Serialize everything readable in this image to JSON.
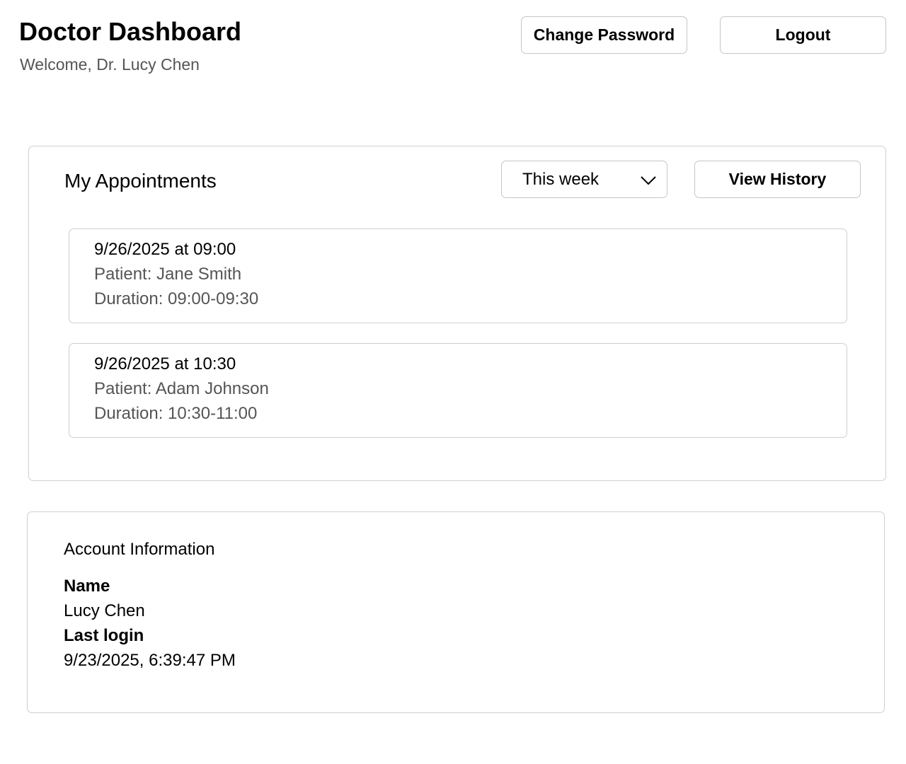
{
  "header": {
    "title": "Doctor Dashboard",
    "subtitle": "Welcome, Dr. Lucy Chen",
    "change_password_label": "Change Password",
    "logout_label": "Logout"
  },
  "appointments": {
    "title": "My Appointments",
    "filter": {
      "selected": "This week"
    },
    "view_history_label": "View History",
    "items": [
      {
        "datetime": "9/26/2025 at 09:00",
        "patient": "Patient: Jane Smith",
        "duration": "Duration: 09:00-09:30"
      },
      {
        "datetime": "9/26/2025 at 10:30",
        "patient": "Patient: Adam Johnson",
        "duration": "Duration: 10:30-11:00"
      }
    ]
  },
  "account": {
    "title": "Account Information",
    "name_label": "Name",
    "name_value": "Lucy Chen",
    "last_login_label": "Last login",
    "last_login_value": "9/23/2025, 6:39:47 PM"
  },
  "icons": {
    "filter_dropdown": "chevron-down-icon"
  },
  "colors": {
    "border": "#cfcfcf",
    "muted_text": "#555555",
    "text": "#000000"
  }
}
